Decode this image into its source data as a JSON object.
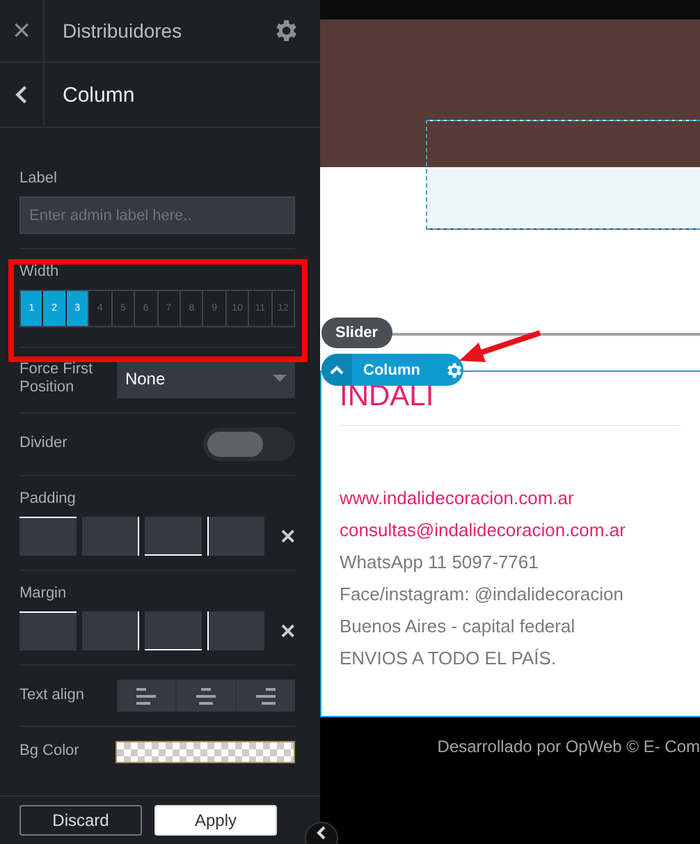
{
  "panel": {
    "close": "×",
    "title": "Distribuidores",
    "subtitle": "Column"
  },
  "label_field": {
    "label": "Label",
    "placeholder": "Enter admin label here.."
  },
  "width": {
    "label": "Width",
    "cells": [
      {
        "text": "1",
        "selected": true
      },
      {
        "text": "2",
        "selected": true
      },
      {
        "text": "3",
        "selected": true
      },
      {
        "text": "4",
        "selected": false
      },
      {
        "text": "5",
        "selected": false
      },
      {
        "text": "6",
        "selected": false
      },
      {
        "text": "7",
        "selected": false
      },
      {
        "text": "8",
        "selected": false
      },
      {
        "text": "9",
        "selected": false
      },
      {
        "text": "10",
        "selected": false
      },
      {
        "text": "11",
        "selected": false
      },
      {
        "text": "12",
        "selected": false
      }
    ]
  },
  "force_first": {
    "label": "Force First Position",
    "value": "None"
  },
  "divider": {
    "label": "Divider",
    "on": false
  },
  "padding": {
    "label": "Padding"
  },
  "margin": {
    "label": "Margin"
  },
  "text_align": {
    "label": "Text align",
    "options": [
      {
        "kind": "left"
      },
      {
        "kind": "center"
      },
      {
        "kind": "right"
      }
    ]
  },
  "bg_color": {
    "label": "Bg Color"
  },
  "buttons": [
    "Discard",
    "Apply"
  ],
  "preview": {
    "slider_badge": "Slider",
    "column_badge": "Column",
    "heading": "INDALI",
    "lines": [
      {
        "kind": "link",
        "text": "www.indalidecoracion.com.ar"
      },
      {
        "kind": "link",
        "text": "consultas@indalidecoracion.com.ar"
      },
      {
        "kind": "plain",
        "text": "WhatsApp 11 5097-7761"
      },
      {
        "kind": "plain",
        "text": "Face/instagram: @indalidecoracion"
      },
      {
        "kind": "plain",
        "text": "Buenos Aires - capital federal"
      },
      {
        "kind": "plain",
        "text": "ENVIOS A TODO EL PAÍS."
      }
    ],
    "footer": "Desarrollado por OpWeb © E- Com"
  }
}
